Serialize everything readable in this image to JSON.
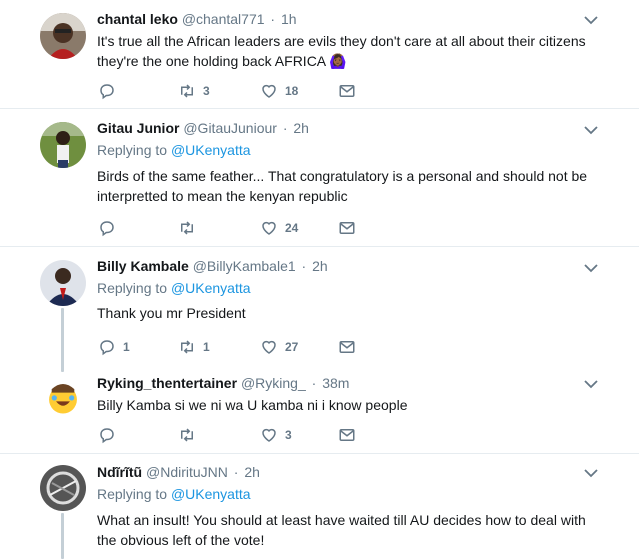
{
  "tweets": [
    {
      "name": "chantal leko",
      "handle": "@chantal771",
      "time": "1h",
      "replying_label": "",
      "replying_to": "",
      "text": "It's true all the African leaders are evils they don't care at all about their citizens they're the one holding back AFRICA 🙆🏾‍♀️",
      "replies": "",
      "retweets": "3",
      "likes": "18"
    },
    {
      "name": "Gitau Junior",
      "handle": "@GitauJuniour",
      "time": "2h",
      "replying_label": "Replying to",
      "replying_to": "@UKenyatta",
      "text": "Birds of the same feather... That congratulatory is a personal and should not be interpretted to mean the kenyan republic",
      "replies": "",
      "retweets": "",
      "likes": "24"
    },
    {
      "name": "Billy Kambale",
      "handle": "@BillyKambale1",
      "time": "2h",
      "replying_label": "Replying to",
      "replying_to": "@UKenyatta",
      "text": "Thank you mr President",
      "replies": "1",
      "retweets": "1",
      "likes": "27"
    },
    {
      "name": "Ryking_thentertainer",
      "handle": "@Ryking_",
      "time": "38m",
      "replying_label": "",
      "replying_to": "",
      "text": "Billy Kamba  si we ni wa U kamba ni i know people",
      "replies": "",
      "retweets": "",
      "likes": "3"
    },
    {
      "name": "Ndĩrĩtũ",
      "handle": "@NdirituJNN",
      "time": "2h",
      "replying_label": "Replying to",
      "replying_to": "@UKenyatta",
      "text": "What an insult! You should at least have waited till AU decides how to deal with the obvious left of the vote!",
      "replies": "",
      "retweets": "",
      "likes": ""
    }
  ],
  "separator": "·",
  "colors": {
    "accent": "#1b95e0",
    "muted": "#657786",
    "text": "#14171a",
    "border": "#e6ecf0",
    "thread": "#c4cfd6"
  },
  "icons": [
    "reply-icon",
    "retweet-icon",
    "like-icon",
    "direct-message-icon",
    "chevron-down-icon"
  ]
}
